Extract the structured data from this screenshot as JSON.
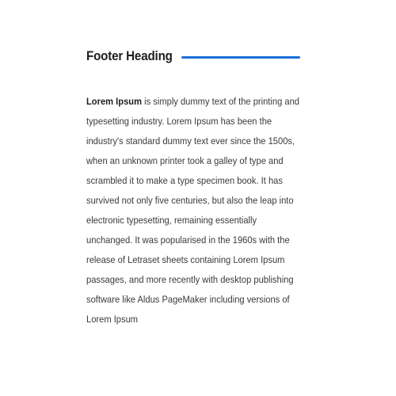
{
  "footer": {
    "heading": "Footer Heading",
    "accent_color": "#1a6fd6",
    "lead": "Lorem Ipsum",
    "body": " is simply dummy text of the printing and typesetting industry. Lorem Ipsum has been the industry's standard dummy text ever since the 1500s, when an unknown printer took a galley of type and scrambled it to make a type specimen book. It has survived not only five centuries, but also the leap into electronic typesetting, remaining essentially unchanged. It was popularised in the 1960s with the release of Letraset sheets containing Lorem Ipsum passages, and more recently with desktop publishing software like Aldus PageMaker including versions of Lorem Ipsum"
  }
}
